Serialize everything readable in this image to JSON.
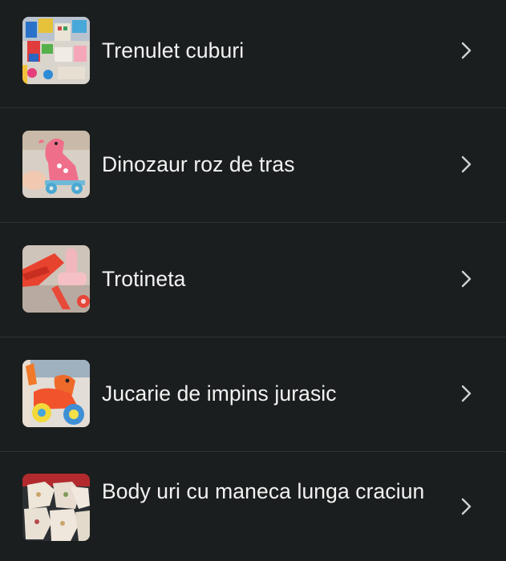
{
  "list": {
    "items": [
      {
        "label": "Trenulet cuburi",
        "thumbnail": "wooden-block-train-photo"
      },
      {
        "label": "Dinozaur roz de tras",
        "thumbnail": "pink-dinosaur-pull-toy-photo"
      },
      {
        "label": "Trotineta",
        "thumbnail": "pink-scooter-photo"
      },
      {
        "label": "Jucarie de impins jurasic",
        "thumbnail": "dinosaur-push-toy-photo"
      },
      {
        "label": "Body uri cu maneca lunga craciun",
        "thumbnail": "christmas-bodysuits-photo"
      }
    ]
  },
  "icons": {
    "chevron": "chevron-right-icon"
  },
  "colors": {
    "background": "#1b1e1f",
    "divider": "#2f3435",
    "text": "#f2f2f2",
    "chevron": "#cfd2d3"
  }
}
